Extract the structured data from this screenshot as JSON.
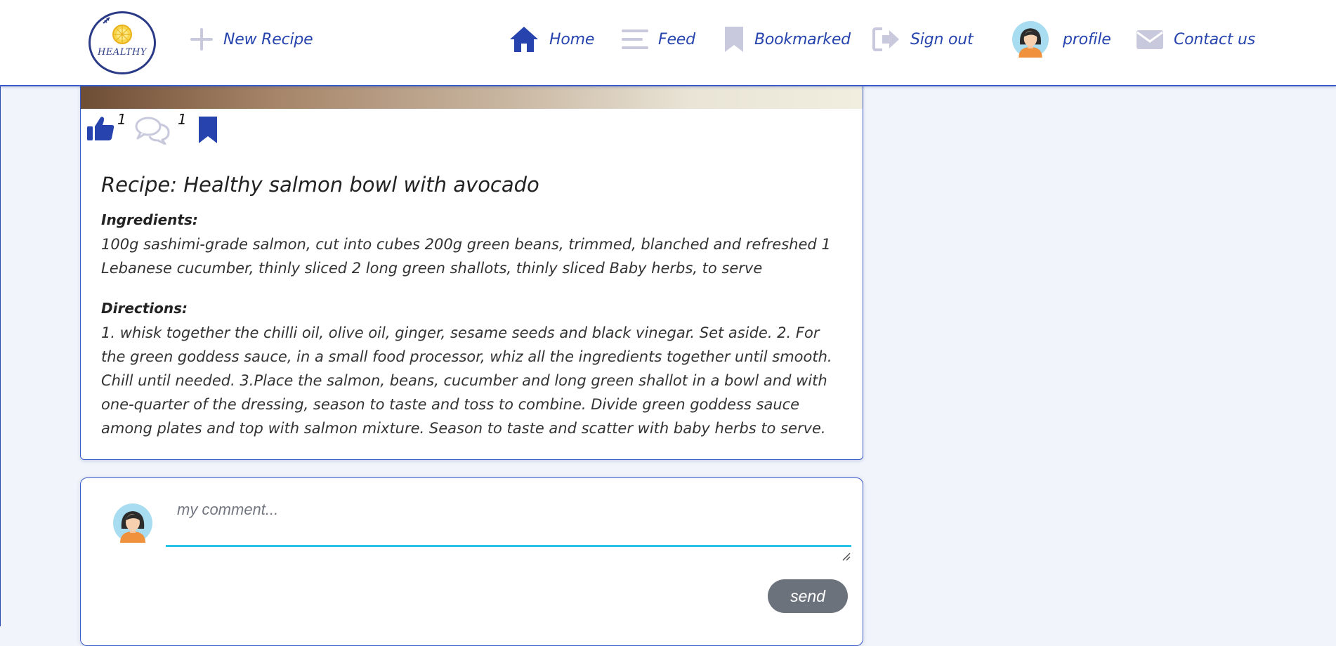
{
  "navbar": {
    "logo_text": "HEALTHY",
    "new_recipe": "New Recipe",
    "home": "Home",
    "feed": "Feed",
    "bookmarked": "Bookmarked",
    "sign_out": "Sign out",
    "profile": "profile",
    "contact": "Contact us"
  },
  "icons": {
    "new_recipe": "plus-icon",
    "home": "home-icon",
    "feed": "menu-lines-icon",
    "bookmarked": "bookmark-icon",
    "sign_out": "sign-out-icon",
    "profile": "avatar-icon",
    "contact": "envelope-icon"
  },
  "colors": {
    "accent": "#2744ae",
    "icon_muted": "#c9c9dd",
    "input_underline": "#29c3e6",
    "send_button": "#6c727c",
    "page_background": "#f1f4fa"
  },
  "recipe": {
    "likes": "1",
    "comments": "1",
    "title": "Recipe: Healthy salmon bowl with avocado",
    "ingredients_label": "Ingredients:",
    "ingredients": "100g sashimi-grade salmon, cut into cubes 200g green beans, trimmed, blanched and refreshed 1 Lebanese cucumber, thinly sliced 2 long green shallots, thinly sliced Baby herbs, to serve",
    "directions_label": "Directions:",
    "directions": "1. whisk together the chilli oil, olive oil, ginger, sesame seeds and black vinegar. Set aside. 2. For the green goddess sauce, in a small food processor, whiz all the ingredients together until smooth. Chill until needed. 3.Place the salmon, beans, cucumber and long green shallot in a bowl and with one-quarter of the dressing, season to taste and toss to combine. Divide green goddess sauce among plates and top with salmon mixture. Season to taste and scatter with baby herbs to serve."
  },
  "comment_form": {
    "placeholder": "my comment...",
    "value": "",
    "send_label": "send"
  }
}
